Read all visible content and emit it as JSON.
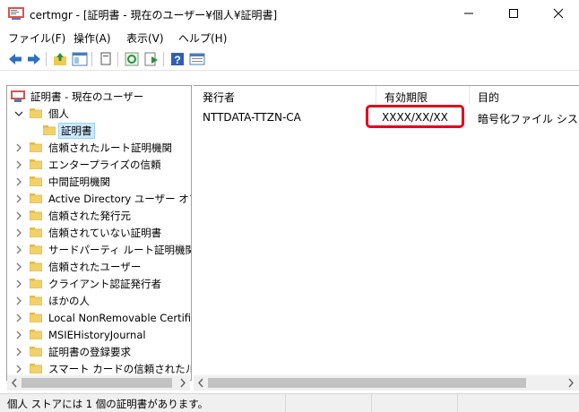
{
  "window": {
    "title": "certmgr - [証明書 - 現在のユーザー¥個人¥証明書]"
  },
  "menu": [
    "ファイル(F)",
    "操作(A)",
    "表示(V)",
    "ヘルプ(H)"
  ],
  "tree": {
    "root": "証明書 - 現在のユーザー",
    "items": [
      {
        "label": "個人",
        "expanded": true
      },
      {
        "label": "証明書",
        "selected": true
      },
      {
        "label": "信頼されたルート証明機関"
      },
      {
        "label": "エンタープライズの信頼"
      },
      {
        "label": "中間証明機関"
      },
      {
        "label": "Active Directory ユーザー オブジ"
      },
      {
        "label": "信頼された発行元"
      },
      {
        "label": "信頼されていない証明書"
      },
      {
        "label": "サードパーティ ルート証明機関"
      },
      {
        "label": "信頼されたユーザー"
      },
      {
        "label": "クライアント認証発行者"
      },
      {
        "label": "ほかの人"
      },
      {
        "label": "Local NonRemovable Certific"
      },
      {
        "label": "MSIEHistoryJournal"
      },
      {
        "label": "証明書の登録要求"
      },
      {
        "label": "スマート カードの信頼されたルート"
      }
    ]
  },
  "list": {
    "columns": [
      "発行者",
      "有効期限",
      "目的"
    ],
    "rows": [
      {
        "issuer": "NTTDATA-TTZN-CA",
        "expires": "XXXX/XX/XX",
        "purpose": "暗号化ファイル システム"
      }
    ]
  },
  "status": {
    "text": "個人 ストアには 1 個の証明書があります。"
  },
  "colors": {
    "highlight": "#e3001b",
    "folder": "#f2d16b",
    "selection": "#cce8ff"
  }
}
